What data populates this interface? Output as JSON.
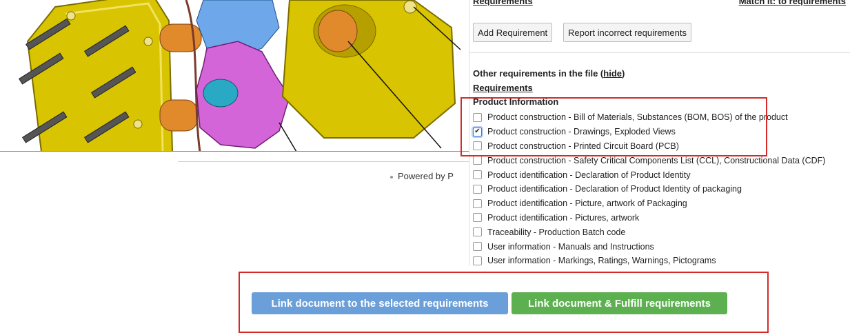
{
  "header": {
    "requirements_label": "Requirements",
    "match_label": "Match it:   to requirements"
  },
  "actions": {
    "add_requirement": "Add Requirement",
    "report_incorrect": "Report incorrect requirements"
  },
  "other": {
    "title": "Other requirements in the file (",
    "hide": "hide",
    "title_end": ")",
    "requirements_link": "Requirements",
    "group": "Product Information",
    "items": [
      {
        "label": "Product construction - Bill of Materials, Substances (BOM, BOS) of the product",
        "checked": false
      },
      {
        "label": "Product construction - Drawings, Exploded Views",
        "checked": true
      },
      {
        "label": "Product construction - Printed Circuit Board (PCB)",
        "checked": false
      },
      {
        "label": "Product construction - Safety Critical Components List (CCL), Constructional Data (CDF)",
        "checked": false
      },
      {
        "label": "Product identification - Declaration of Product Identity",
        "checked": false
      },
      {
        "label": "Product identification - Declaration of Product Identity of packaging",
        "checked": false
      },
      {
        "label": "Product identification - Picture, artwork of Packaging",
        "checked": false
      },
      {
        "label": "Product identification - Pictures, artwork",
        "checked": false
      },
      {
        "label": "Traceability - Production Batch code",
        "checked": false
      },
      {
        "label": "User information - Manuals and Instructions",
        "checked": false
      },
      {
        "label": "User information - Markings, Ratings, Warnings, Pictograms",
        "checked": false
      }
    ]
  },
  "footer": {
    "powered": "Powered by P"
  },
  "bottom": {
    "link_selected": "Link document to the selected requirements",
    "link_fulfill": "Link document & Fulfill requirements"
  },
  "colors": {
    "blue_button": "#6b9fd9",
    "green_button": "#5cb04f",
    "highlight_border": "#d42a2a"
  }
}
